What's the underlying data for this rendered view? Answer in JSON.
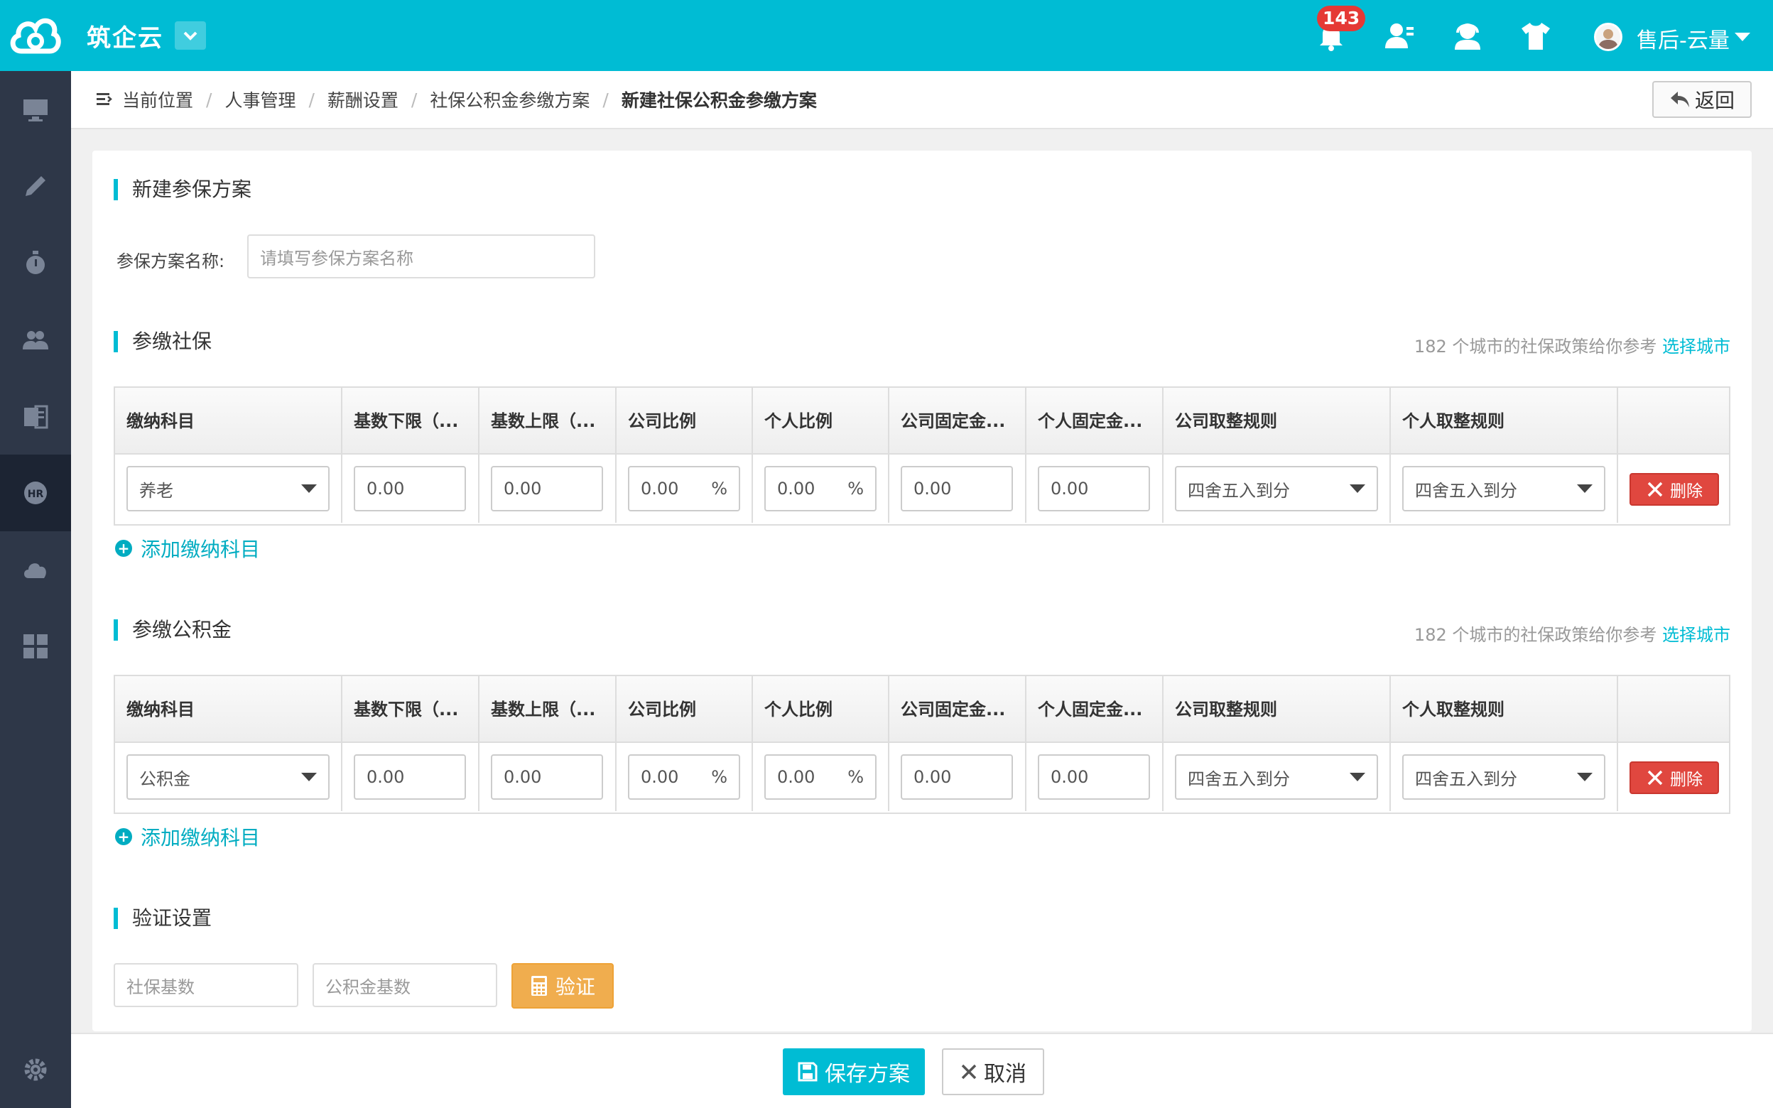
{
  "app": {
    "name": "筑企云"
  },
  "topbar": {
    "notification_count": "143",
    "user_name": "售后-云量"
  },
  "sidebar": {
    "items": [
      "monitor-icon",
      "pencil-icon",
      "timer-icon",
      "people-icon",
      "ok-form-icon",
      "hr-icon",
      "cloud-icon",
      "grid-icon",
      "settings-icon"
    ]
  },
  "breadcrumb": {
    "prefix": "当前位置",
    "items": [
      "人事管理",
      "薪酬设置",
      "社保公积金参缴方案"
    ],
    "current": "新建社保公积金参缴方案",
    "back_label": "返回"
  },
  "plan": {
    "section_title": "新建参保方案",
    "name_label": "参保方案名称:",
    "name_placeholder": "请填写参保方案名称"
  },
  "social": {
    "title": "参缴社保",
    "hint_text": "182 个城市的社保政策给你参考",
    "hint_link": "选择城市",
    "add_label": "添加缴纳科目",
    "row": {
      "item": "养老",
      "base_min": "0.00",
      "base_max": "0.00",
      "company_rate": "0.00",
      "personal_rate": "0.00",
      "company_fixed": "0.00",
      "personal_fixed": "0.00",
      "company_round": "四舍五入到分",
      "personal_round": "四舍五入到分",
      "delete": "删除"
    }
  },
  "fund": {
    "title": "参缴公积金",
    "hint_text": "182 个城市的社保政策给你参考",
    "hint_link": "选择城市",
    "add_label": "添加缴纳科目",
    "row": {
      "item": "公积金",
      "base_min": "0.00",
      "base_max": "0.00",
      "company_rate": "0.00",
      "personal_rate": "0.00",
      "company_fixed": "0.00",
      "personal_fixed": "0.00",
      "company_round": "四舍五入到分",
      "personal_round": "四舍五入到分",
      "delete": "删除"
    }
  },
  "table_headers": [
    "缴纳科目",
    "基数下限（...",
    "基数上限（...",
    "公司比例",
    "个人比例",
    "公司固定金...",
    "个人固定金...",
    "公司取整规则",
    "个人取整规则",
    ""
  ],
  "percent_sign": "%",
  "verify": {
    "title": "验证设置",
    "social_placeholder": "社保基数",
    "fund_placeholder": "公积金基数",
    "button": "验证"
  },
  "footer": {
    "save": "保存方案",
    "cancel": "取消"
  },
  "colors": {
    "primary": "#00bcd4",
    "sidebar": "#2e3748",
    "danger": "#e0473f",
    "warning": "#f0ad4e"
  }
}
